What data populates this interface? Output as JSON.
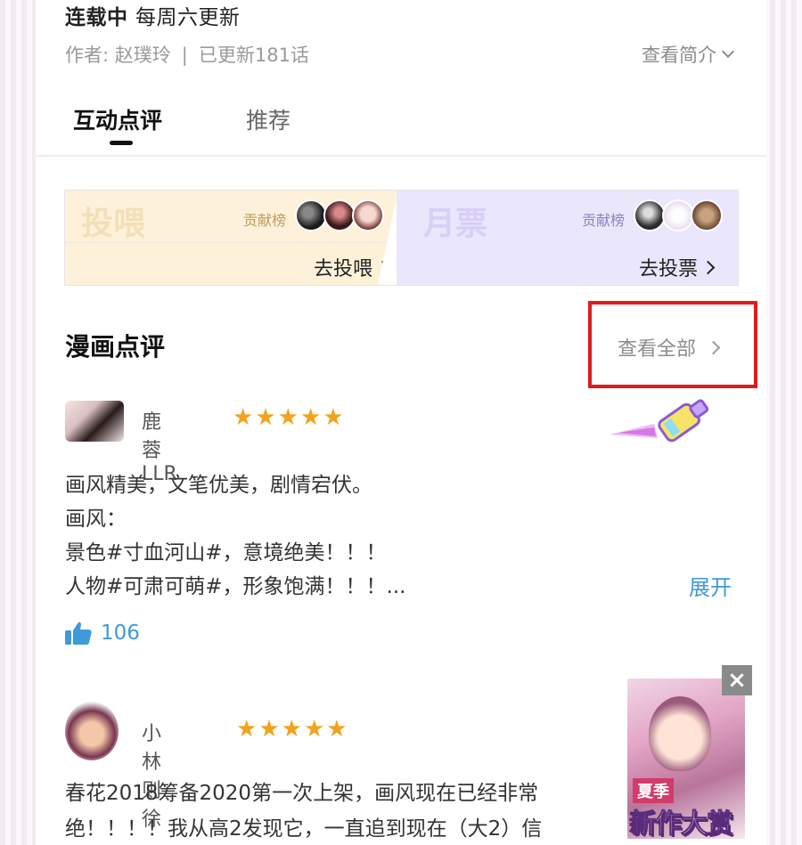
{
  "header": {
    "status": "连载中",
    "schedule": "每周六更新",
    "author": "作者: 赵璞玲",
    "separator": "|",
    "updated": "已更新181话",
    "intro_label": "查看简介"
  },
  "tabs": [
    {
      "label": "互动点评",
      "active": true
    },
    {
      "label": "推荐",
      "active": false
    }
  ],
  "vote": {
    "feed": {
      "title": "投喂",
      "rank_label": "贡献榜",
      "link": "去投喂"
    },
    "ticket": {
      "title": "月票",
      "rank_label": "贡献榜",
      "link": "去投票"
    }
  },
  "comments_section": {
    "title": "漫画点评",
    "view_all": "查看全部"
  },
  "reviews": [
    {
      "user": "鹿蓉LLR",
      "rating": 5,
      "lines": [
        "画风精美，文笔优美，剧情宕伏。",
        "画风：",
        "景色#寸血河山#，意境绝美！！！",
        "人物#可肃可萌#，形象饱满！！！..."
      ],
      "expand": "展开",
      "likes": "106"
    },
    {
      "user": "小林则徐",
      "rating": 5,
      "lines": [
        "春花2018筹备2020第一次上架，画风现在已经非常",
        "绝！！！！我从高2发现它，一直追到现在（大2）信"
      ]
    }
  ],
  "ad": {
    "tag": "夏季",
    "title": "新作大赏",
    "close": "×"
  },
  "colors": {
    "accent_blue": "#3f9ad8",
    "star": "#f2a21d",
    "highlight_box": "#e01b1b"
  }
}
